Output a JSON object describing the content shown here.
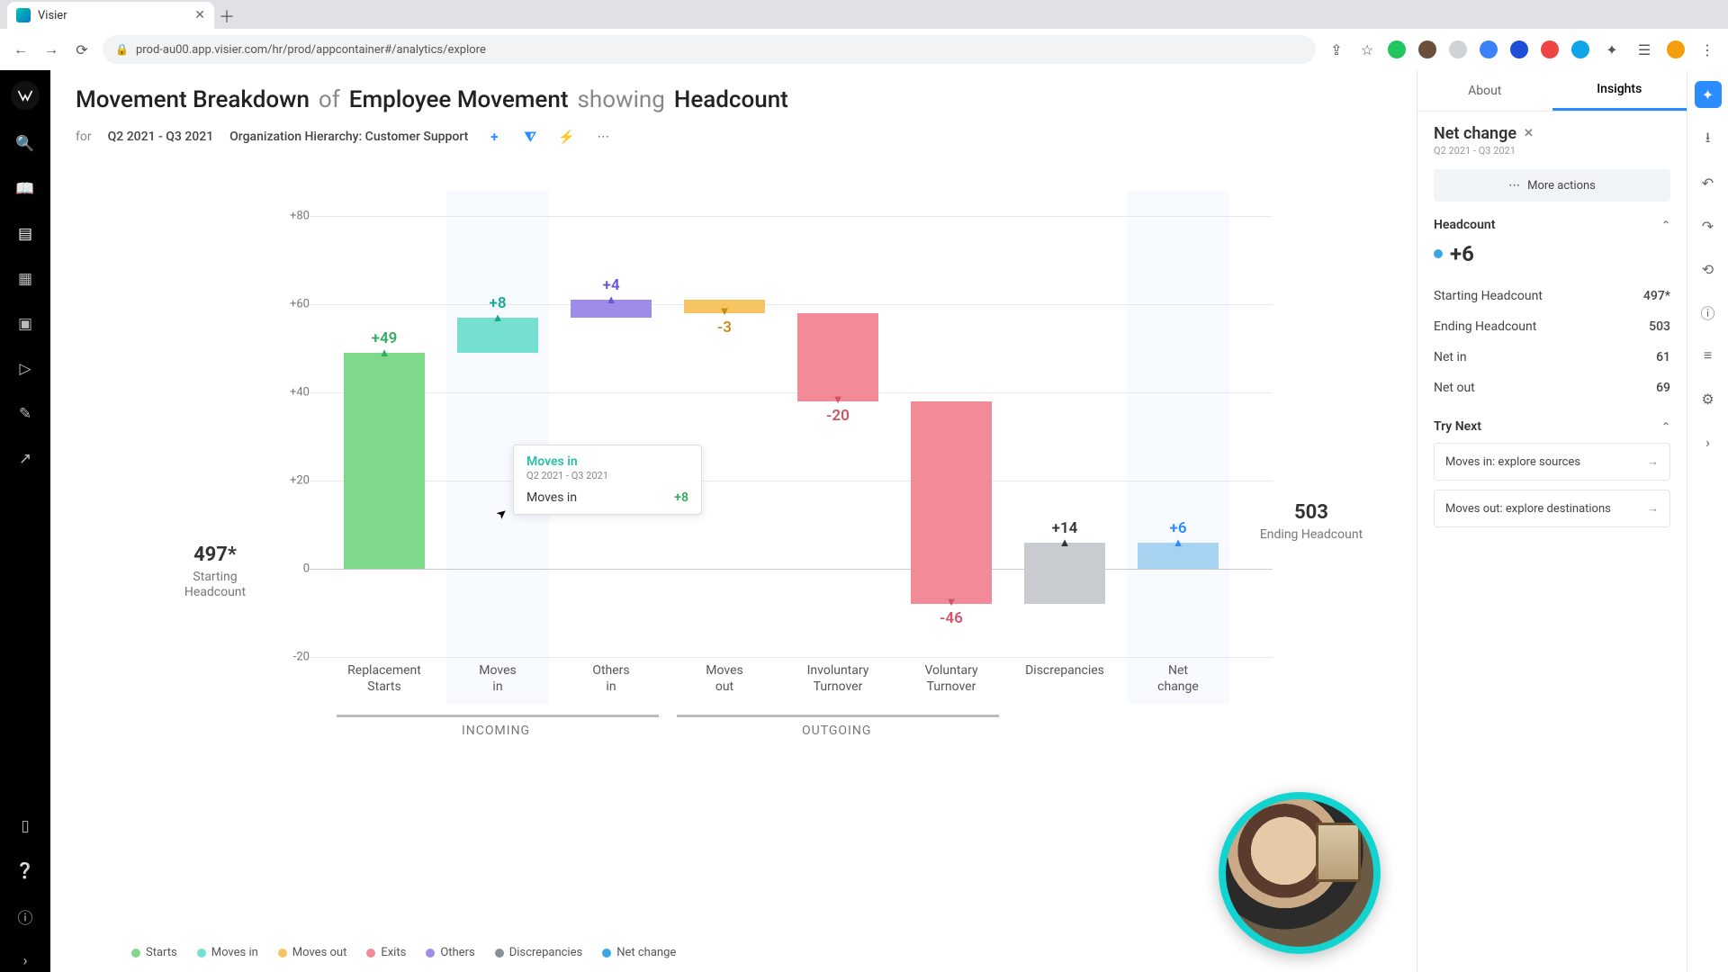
{
  "browser": {
    "tab_title": "Visier",
    "url": "prod-au00.app.visier.com/hr/prod/appcontainer#/analytics/explore"
  },
  "title": {
    "part1": "Movement Breakdown",
    "of": "of",
    "part2": "Employee Movement",
    "showing": "showing",
    "part3": "Headcount"
  },
  "context": {
    "for": "for",
    "period": "Q2 2021 - Q3 2021",
    "filter": "Organization Hierarchy: Customer Support"
  },
  "chart_data": {
    "type": "bar",
    "title": "Movement Breakdown of Employee Movement showing Headcount",
    "ylabel": "",
    "xlabel": "",
    "ylim": [
      -20,
      80
    ],
    "y_ticks": [
      -20,
      0,
      20,
      40,
      60,
      80
    ],
    "starting": {
      "label": "Starting Headcount",
      "value": "497*"
    },
    "ending": {
      "label": "Ending Headcount",
      "value": "503"
    },
    "groups": {
      "incoming": {
        "label": "INCOMING",
        "members": [
          "Replacement Starts",
          "Moves in",
          "Others in"
        ]
      },
      "outgoing": {
        "label": "OUTGOING",
        "members": [
          "Moves out",
          "Involuntary Turnover",
          "Voluntary Turnover"
        ]
      }
    },
    "categories": [
      "Replacement Starts",
      "Moves in",
      "Others in",
      "Moves out",
      "Involuntary Turnover",
      "Voluntary Turnover",
      "Discrepancies",
      "Net change"
    ],
    "series": [
      {
        "name": "Replacement Starts",
        "value": 49,
        "display": "+49",
        "color": "#7fd98b",
        "legend": "Starts",
        "base": 0,
        "top": 49,
        "dir": "up"
      },
      {
        "name": "Moves in",
        "value": 8,
        "display": "+8",
        "color": "#76e0d0",
        "legend": "Moves in",
        "base": 49,
        "top": 57,
        "dir": "up"
      },
      {
        "name": "Others in",
        "value": 4,
        "display": "+4",
        "color": "#9f8ce8",
        "legend": "Others",
        "base": 57,
        "top": 61,
        "dir": "up"
      },
      {
        "name": "Moves out",
        "value": -3,
        "display": "-3",
        "color": "#f4c560",
        "legend": "Moves out",
        "base": 61,
        "top": 58,
        "dir": "down"
      },
      {
        "name": "Involuntary Turnover",
        "value": -20,
        "display": "-20",
        "color": "#f28a97",
        "legend": "Exits",
        "base": 58,
        "top": 38,
        "dir": "down"
      },
      {
        "name": "Voluntary Turnover",
        "value": -46,
        "display": "-46",
        "color": "#f28a97",
        "legend": "Exits",
        "base": 38,
        "top": -8,
        "dir": "down"
      },
      {
        "name": "Discrepancies",
        "value": 14,
        "display": "+14",
        "color": "#c8ccd0",
        "legend": "Discrepancies",
        "base": -8,
        "top": 6,
        "dir": "up"
      },
      {
        "name": "Net change",
        "value": 6,
        "display": "+6",
        "color": "#a7d3f2",
        "legend": "Net change",
        "base": 0,
        "top": 6,
        "dir": "up"
      }
    ]
  },
  "tooltip": {
    "title": "Moves in",
    "sub": "Q2 2021 - Q3 2021",
    "row_label": "Moves in",
    "row_value": "+8"
  },
  "legend": [
    {
      "label": "Starts",
      "color": "#7fd98b"
    },
    {
      "label": "Moves in",
      "color": "#76e0d0"
    },
    {
      "label": "Moves out",
      "color": "#f4c560"
    },
    {
      "label": "Exits",
      "color": "#f28a97"
    },
    {
      "label": "Others",
      "color": "#9f8ce8"
    },
    {
      "label": "Discrepancies",
      "color": "#8a8f94"
    },
    {
      "label": "Net change",
      "color": "#3aa7e6"
    }
  ],
  "insights": {
    "tabs": {
      "about": "About",
      "insights": "Insights"
    },
    "card_title": "Net change",
    "card_sub": "Q2 2021 - Q3 2021",
    "more_actions": "More actions",
    "headcount_label": "Headcount",
    "headcount_value": "+6",
    "stats": [
      {
        "label": "Starting Headcount",
        "value": "497*"
      },
      {
        "label": "Ending Headcount",
        "value": "503"
      },
      {
        "label": "Net in",
        "value": "61"
      },
      {
        "label": "Net out",
        "value": "69"
      }
    ],
    "try_next_label": "Try Next",
    "try_next": [
      "Moves in: explore sources",
      "Moves out: explore destinations"
    ]
  }
}
